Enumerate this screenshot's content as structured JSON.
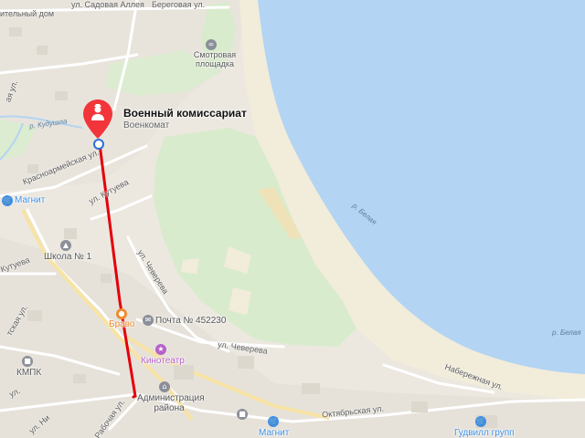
{
  "colors": {
    "water": "#b3d4f3",
    "forest": "#d9ebcd",
    "beach": "#f2ecda",
    "route": "#e3000b",
    "pin": "#f2353a",
    "shop": "#3d8fe6",
    "gray_poi": "#8a8f99",
    "cinema": "#b660c9",
    "cafe": "#f08a2d"
  },
  "selected": {
    "title": "Военный комиссариат",
    "subtitle": "Военкомат",
    "icon": "military-officer-icon"
  },
  "streets": {
    "top_left": "ительный дом",
    "sadovaya": "ул. Садовая Аллея",
    "beregovaya": "Береговая ул.",
    "kudushla": "р. Кудушла",
    "krasnoarmeyskaya": "Красноармейская ул.",
    "kutueva": "ул. Кутуева",
    "kutueva_left": "Кутуева",
    "chevereva_upper": "ул. Чеверева",
    "chevereva_lower": "ул. Чеверева",
    "oktyabrskaya": "Октябрьская ул.",
    "naberezhnaya": "Набережная ул.",
    "rabochaya": "Рабочая ул.",
    "left_lower": "ул.",
    "left_lower2": "ул. Ни",
    "left_side": "тская ул.",
    "left_top": "ая ул."
  },
  "rivers": {
    "belaya_upper": "р. Белая",
    "belaya_lower": "р. Белая"
  },
  "pois": {
    "viewpoint": "Смотровая площадка",
    "magnit_top": "Магнит",
    "school": "Школа № 1",
    "bravo": "Браво",
    "post": "Почта № 452230",
    "kinoteatr": "Кинотеатр",
    "kmpk": "КМПК",
    "administration": "Администрация района",
    "magnit_bottom": "Магнит",
    "goodwill": "Гудвилл групп"
  }
}
